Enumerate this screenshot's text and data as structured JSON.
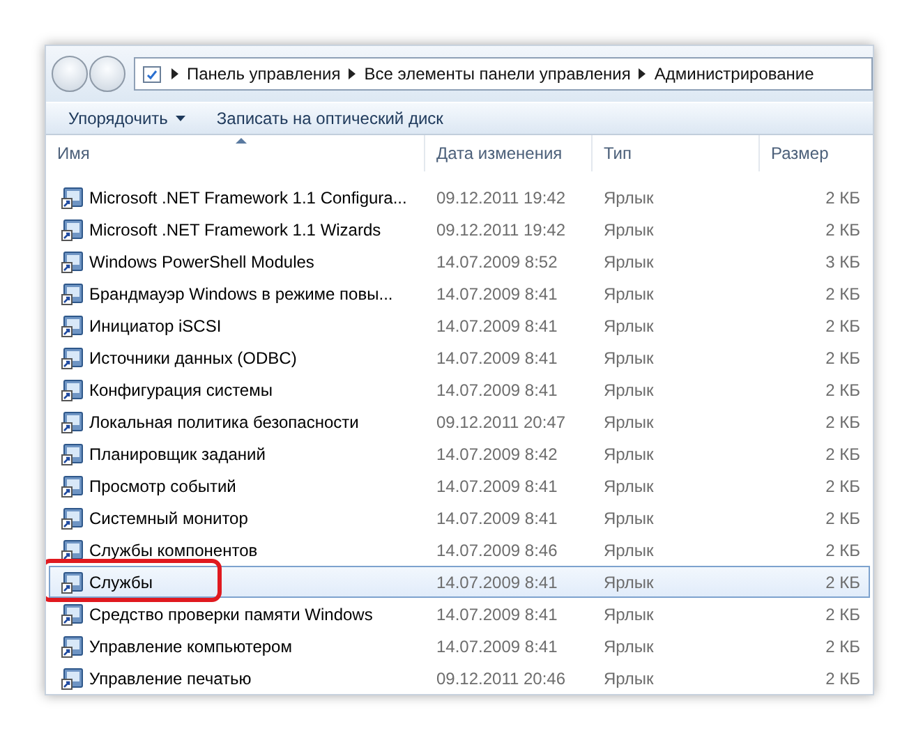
{
  "address": {
    "crumbs": [
      "Панель управления",
      "Все элементы панели управления",
      "Администрирование"
    ]
  },
  "toolbar": {
    "buttons": [
      {
        "label": "Упорядочить",
        "dropdown": true
      },
      {
        "label": "Записать на оптический диск",
        "dropdown": false
      }
    ]
  },
  "table": {
    "columns": [
      "Имя",
      "Дата изменения",
      "Тип",
      "Размер"
    ],
    "rows": [
      {
        "name": "Microsoft .NET Framework 1.1 Configura...",
        "date": "09.12.2011 19:42",
        "type": "Ярлык",
        "size": "2 КБ",
        "selected": false,
        "annotated": false
      },
      {
        "name": "Microsoft .NET Framework 1.1 Wizards",
        "date": "09.12.2011 19:42",
        "type": "Ярлык",
        "size": "2 КБ",
        "selected": false,
        "annotated": false
      },
      {
        "name": "Windows PowerShell Modules",
        "date": "14.07.2009 8:52",
        "type": "Ярлык",
        "size": "3 КБ",
        "selected": false,
        "annotated": false
      },
      {
        "name": "Брандмауэр Windows в режиме повы...",
        "date": "14.07.2009 8:41",
        "type": "Ярлык",
        "size": "2 КБ",
        "selected": false,
        "annotated": false
      },
      {
        "name": "Инициатор iSCSI",
        "date": "14.07.2009 8:41",
        "type": "Ярлык",
        "size": "2 КБ",
        "selected": false,
        "annotated": false
      },
      {
        "name": "Источники данных (ODBC)",
        "date": "14.07.2009 8:41",
        "type": "Ярлык",
        "size": "2 КБ",
        "selected": false,
        "annotated": false
      },
      {
        "name": "Конфигурация системы",
        "date": "14.07.2009 8:41",
        "type": "Ярлык",
        "size": "2 КБ",
        "selected": false,
        "annotated": false
      },
      {
        "name": "Локальная политика безопасности",
        "date": "09.12.2011 20:47",
        "type": "Ярлык",
        "size": "2 КБ",
        "selected": false,
        "annotated": false
      },
      {
        "name": "Планировщик заданий",
        "date": "14.07.2009 8:42",
        "type": "Ярлык",
        "size": "2 КБ",
        "selected": false,
        "annotated": false
      },
      {
        "name": "Просмотр событий",
        "date": "14.07.2009 8:41",
        "type": "Ярлык",
        "size": "2 КБ",
        "selected": false,
        "annotated": false
      },
      {
        "name": "Системный монитор",
        "date": "14.07.2009 8:41",
        "type": "Ярлык",
        "size": "2 КБ",
        "selected": false,
        "annotated": false
      },
      {
        "name": "Службы компонентов",
        "date": "14.07.2009 8:46",
        "type": "Ярлык",
        "size": "2 КБ",
        "selected": false,
        "annotated": false
      },
      {
        "name": "Службы",
        "date": "14.07.2009 8:41",
        "type": "Ярлык",
        "size": "2 КБ",
        "selected": true,
        "annotated": true
      },
      {
        "name": "Средство проверки памяти Windows",
        "date": "14.07.2009 8:41",
        "type": "Ярлык",
        "size": "2 КБ",
        "selected": false,
        "annotated": false
      },
      {
        "name": "Управление компьютером",
        "date": "14.07.2009 8:41",
        "type": "Ярлык",
        "size": "2 КБ",
        "selected": false,
        "annotated": false
      },
      {
        "name": "Управление печатью",
        "date": "09.12.2011 20:46",
        "type": "Ярлык",
        "size": "2 КБ",
        "selected": false,
        "annotated": false
      }
    ]
  }
}
